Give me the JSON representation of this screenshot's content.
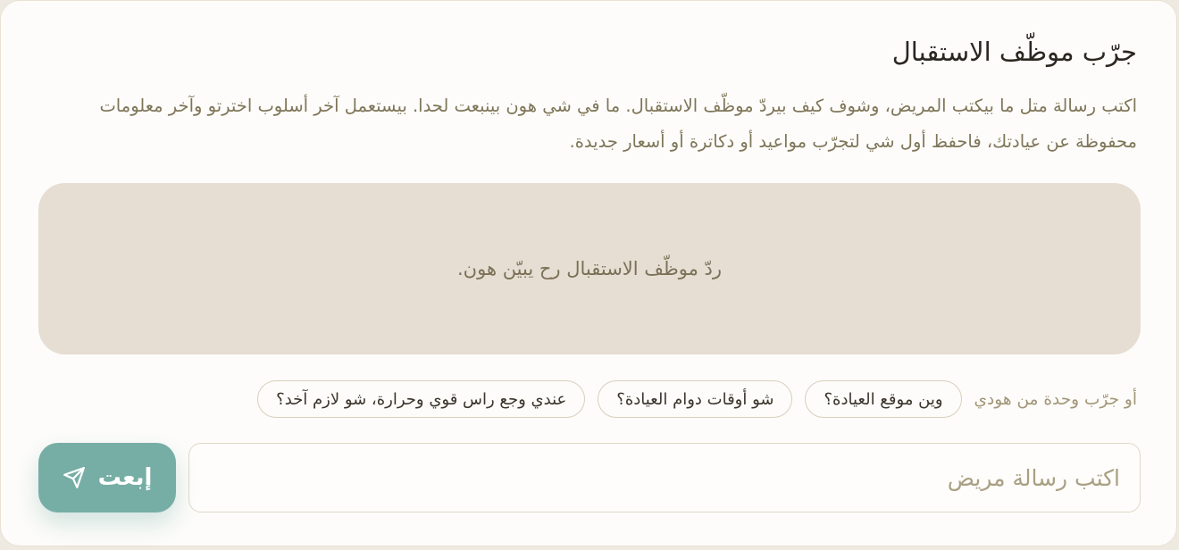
{
  "panel": {
    "title": "جرّب موظّف الاستقبال",
    "description": "اكتب رسالة متل ما بيكتب المريض، وشوف كيف بيردّ موظّف الاستقبال. ما في شي هون بينبعت لحدا. بيستعمل آخر أسلوب اخترتو وآخر معلومات محفوظة عن عيادتك، فاحفظ أول شي لتجرّب مواعيد أو دكاترة أو أسعار جديدة."
  },
  "response": {
    "placeholder_text": "ردّ موظّف الاستقبال رح يبيّن هون."
  },
  "suggestions": {
    "label": "أو جرّب وحدة من هودي",
    "items": [
      "وين موقع العيادة؟",
      "شو أوقات دوام العيادة؟",
      "عندي وجع راس قوي وحرارة، شو لازم آخد؟"
    ]
  },
  "composer": {
    "input_value": "",
    "input_placeholder": "اكتب رسالة مريض",
    "send_label": "إبعت",
    "send_icon": "paper-plane-icon"
  },
  "colors": {
    "accent": "#76aea5",
    "response_bg": "#e6ddd3",
    "muted_text": "#7f7659"
  }
}
